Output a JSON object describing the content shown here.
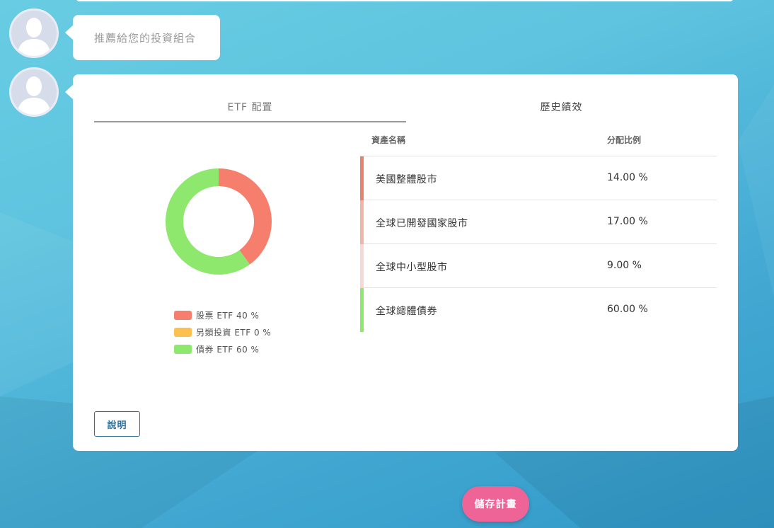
{
  "message": {
    "text": "推薦給您的投資組合"
  },
  "tabs": [
    {
      "label": "ETF 配置",
      "active": true
    },
    {
      "label": "歷史績效",
      "active": false
    }
  ],
  "chart_data": {
    "type": "pie",
    "style": "donut",
    "slices": [
      {
        "label": "股票 ETF 40 %",
        "value": 40,
        "color": "#f57f6c"
      },
      {
        "label": "另類投資 ETF 0 %",
        "value": 0,
        "color": "#fdbf4d"
      },
      {
        "label": "債券 ETF 60 %",
        "value": 60,
        "color": "#8ee86e"
      }
    ]
  },
  "table": {
    "headers": {
      "name": "資產名稱",
      "ratio": "分配比例"
    },
    "rows": [
      {
        "name": "美國整體股市",
        "ratio": "14.00 %",
        "color": "#e8826e"
      },
      {
        "name": "全球已開發國家股市",
        "ratio": "17.00 %",
        "color": "#f2b3a8"
      },
      {
        "name": "全球中小型股市",
        "ratio": "9.00 %",
        "color": "#f8d8d3"
      },
      {
        "name": "全球總體債券",
        "ratio": "60.00 %",
        "color": "#8ee86e"
      }
    ]
  },
  "buttons": {
    "explain": "說明",
    "save": "儲存計畫"
  },
  "colors": {
    "save_button": "#ee6497",
    "explain_border": "#2f6f99"
  },
  "icons": {
    "avatar": "user-silhouette-icon"
  }
}
